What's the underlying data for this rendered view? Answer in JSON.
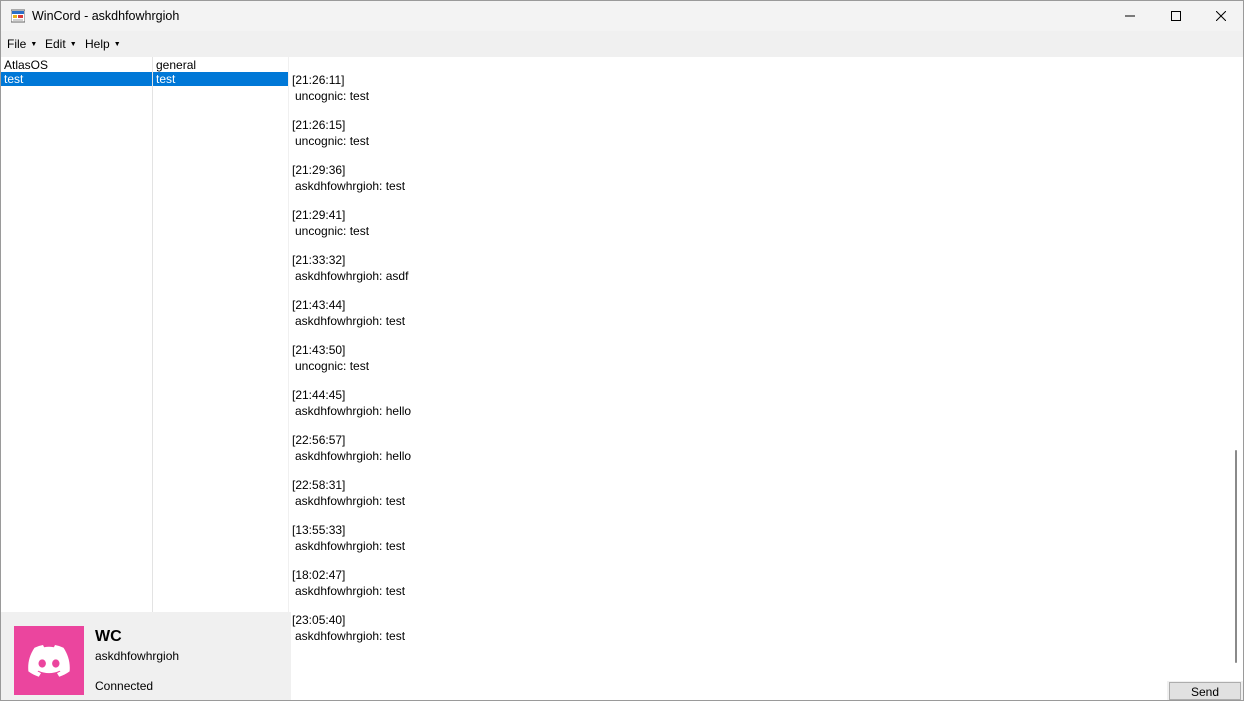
{
  "window": {
    "title": "WinCord - askdhfowhrgioh"
  },
  "menu": {
    "file": "File",
    "edit": "Edit",
    "help": "Help"
  },
  "servers": {
    "header": "AtlasOS",
    "items": [
      {
        "label": "test",
        "selected": true
      }
    ]
  },
  "channels": {
    "header": "general",
    "items": [
      {
        "label": "test",
        "selected": true
      }
    ]
  },
  "messages": [
    {
      "time": "[21:26:11]",
      "text": "uncognic: test"
    },
    {
      "time": "[21:26:15]",
      "text": "uncognic: test"
    },
    {
      "time": "[21:29:36]",
      "text": "askdhfowhrgioh: test"
    },
    {
      "time": "[21:29:41]",
      "text": "uncognic: test"
    },
    {
      "time": "[21:33:32]",
      "text": "askdhfowhrgioh: asdf"
    },
    {
      "time": "[21:43:44]",
      "text": "askdhfowhrgioh: test"
    },
    {
      "time": "[21:43:50]",
      "text": "uncognic: test"
    },
    {
      "time": "[21:44:45]",
      "text": "askdhfowhrgioh: hello"
    },
    {
      "time": "[22:56:57]",
      "text": "askdhfowhrgioh: hello"
    },
    {
      "time": "[22:58:31]",
      "text": "askdhfowhrgioh: test"
    },
    {
      "time": "[13:55:33]",
      "text": "askdhfowhrgioh: test"
    },
    {
      "time": "[18:02:47]",
      "text": "askdhfowhrgioh: test"
    },
    {
      "time": "[23:05:40]",
      "text": "askdhfowhrgioh: test"
    }
  ],
  "composer": {
    "value": "",
    "send_label": "Send"
  },
  "profile": {
    "name": "WC",
    "username": "askdhfowhrgioh",
    "status": "Connected",
    "avatar_color": "#eb459e",
    "avatar_icon": "discord-logo-icon"
  },
  "colors": {
    "selection": "#0078d7"
  }
}
